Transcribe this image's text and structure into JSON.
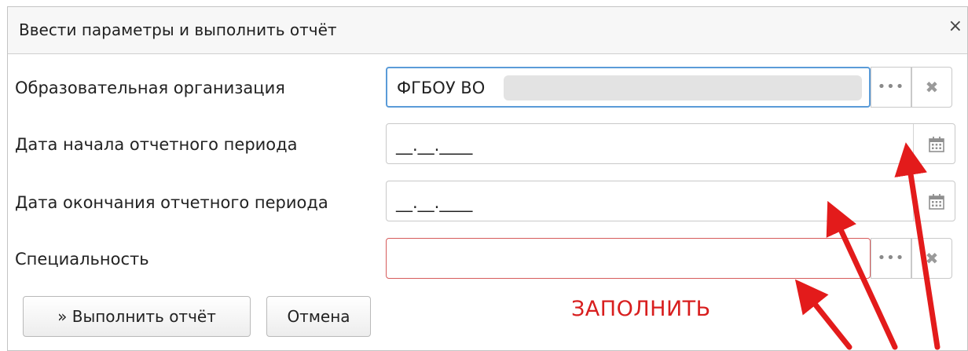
{
  "dialog": {
    "title": "Ввести параметры и выполнить отчёт",
    "close_glyph": "×"
  },
  "fields": [
    {
      "label": "Образовательная организация",
      "value": "ФГБОУ ВО",
      "icons": [
        "dots-icon",
        "clear-icon"
      ]
    },
    {
      "label": "Дата начала отчетного периода",
      "value": "__.__.____",
      "icons": [
        "calendar-icon"
      ]
    },
    {
      "label": "Дата окончания отчетного периода",
      "value": "__.__.____",
      "icons": [
        "calendar-icon"
      ]
    },
    {
      "label": "Специальность",
      "value": "",
      "icons": [
        "dots-icon",
        "clear-icon"
      ]
    }
  ],
  "glyphs": {
    "dots": "•••",
    "clear": "✖"
  },
  "buttons": {
    "run": "» Выполнить отчёт",
    "cancel": "Отмена"
  },
  "annotation": {
    "text": "ЗАПОЛНИТЬ",
    "color": "#d81e1e"
  },
  "colors": {
    "focus_border": "#5a9bd8",
    "error_border": "#d65b5b",
    "arrow": "#e31b1b"
  }
}
